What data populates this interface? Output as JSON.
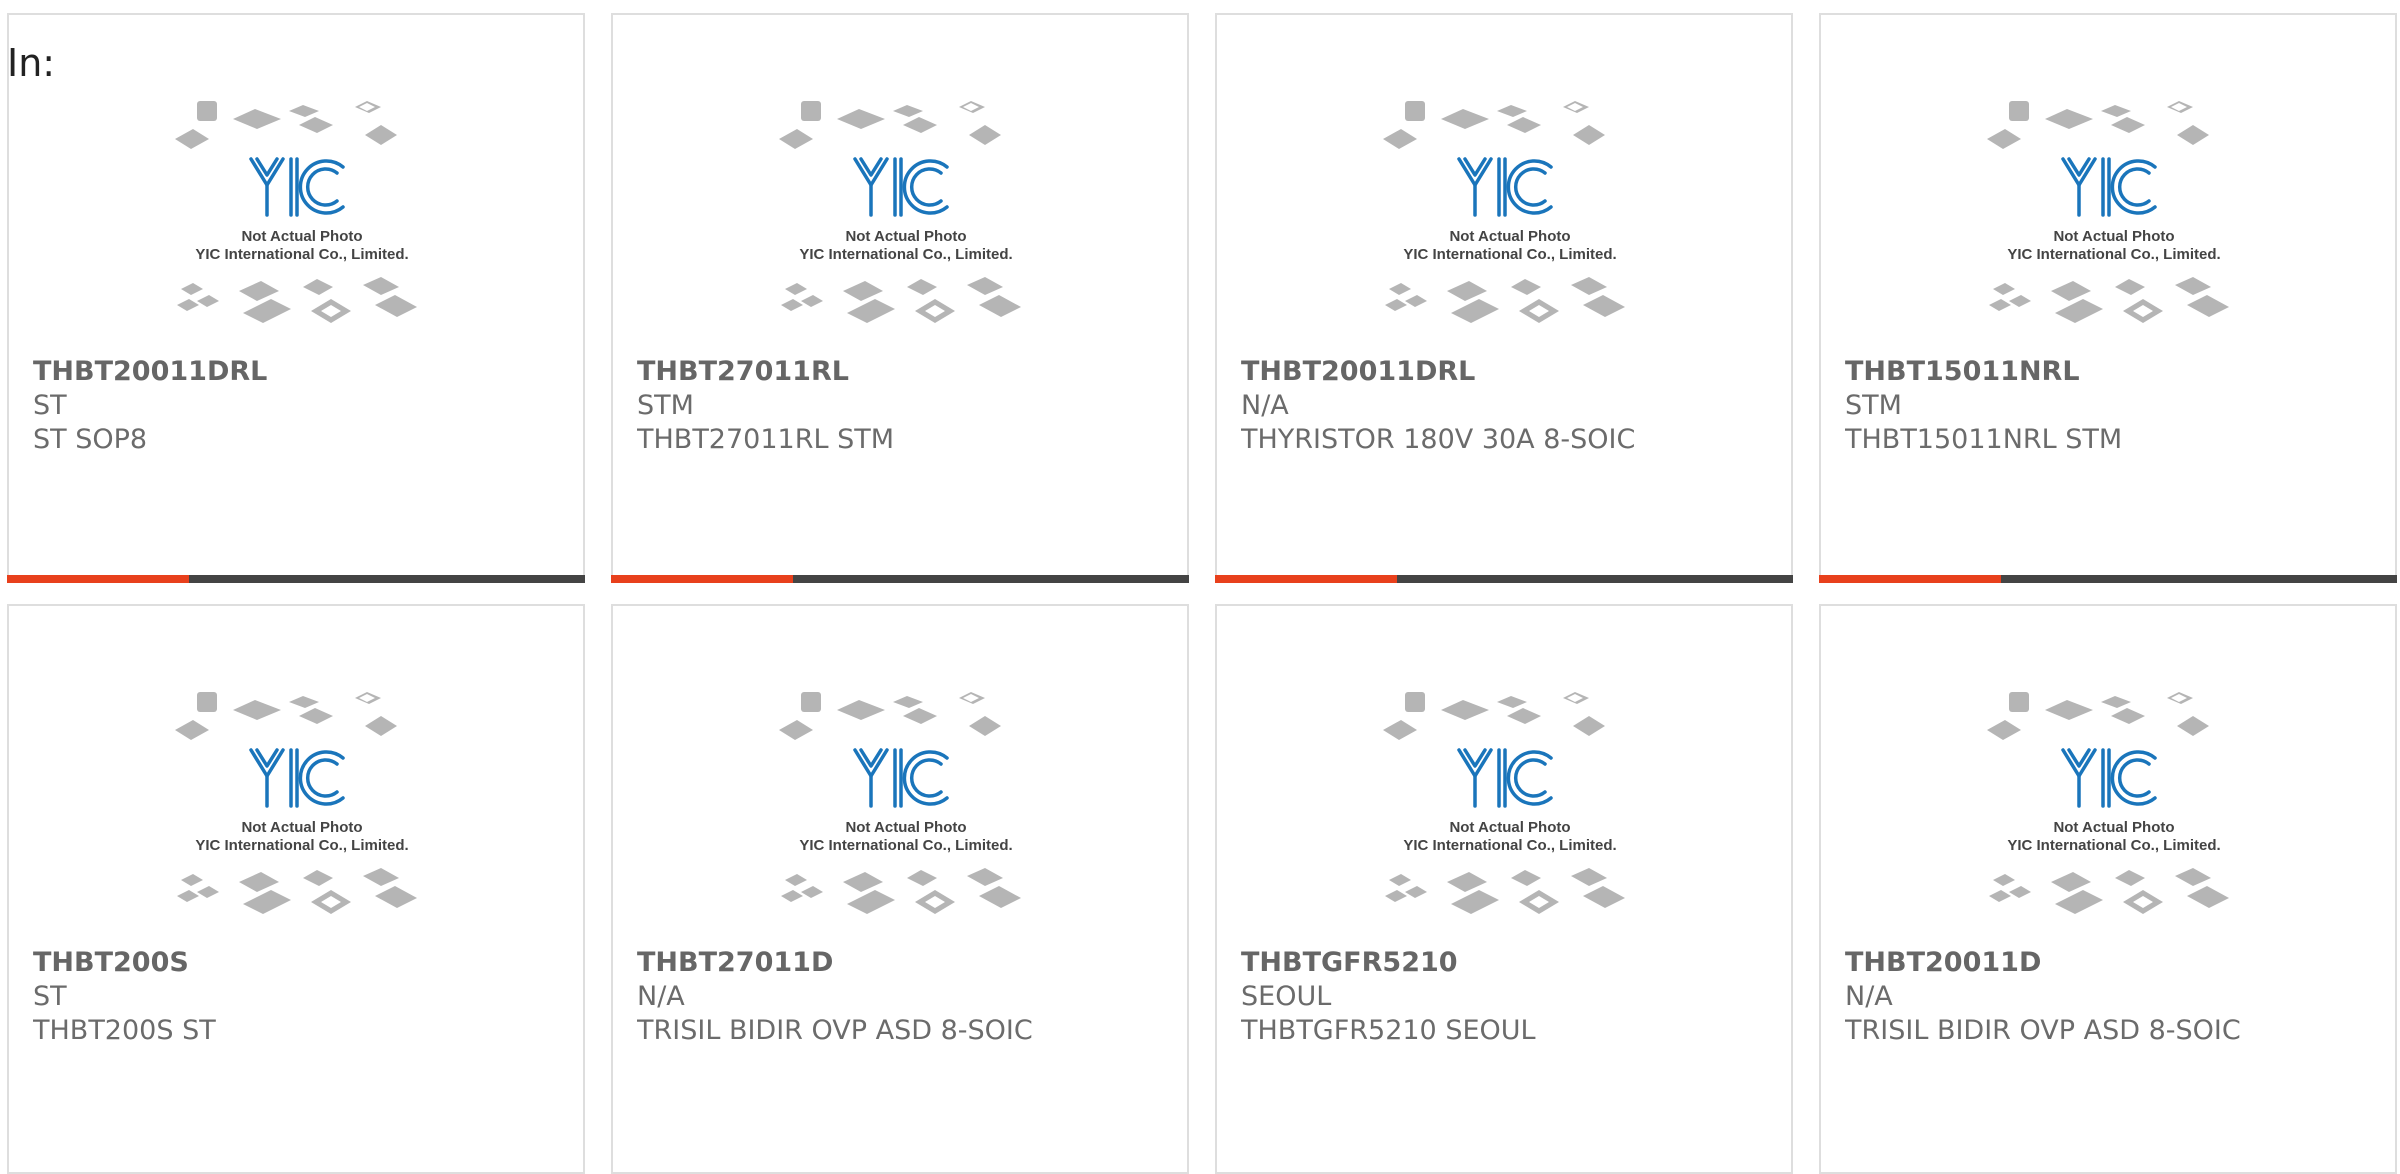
{
  "page": {
    "label": "In:"
  },
  "placeholder_image": {
    "caption_line1": "Not Actual Photo",
    "caption_line2": "YIC International Co., Limited.",
    "logo_text": "YIC",
    "logo_color": "#1a75bb",
    "chip_color": "#b5b5b5"
  },
  "colors": {
    "accent_bar": "#e8401c",
    "bar_base": "#444444",
    "border": "#dedede"
  },
  "products": [
    {
      "part": "THBT20011DRL",
      "manufacturer": "ST",
      "description": "ST SOP8",
      "accent_bar": true
    },
    {
      "part": "THBT27011RL",
      "manufacturer": "STM",
      "description": "THBT27011RL STM",
      "accent_bar": true
    },
    {
      "part": "THBT20011DRL",
      "manufacturer": "N/A",
      "description": "THYRISTOR 180V 30A 8-SOIC",
      "accent_bar": true
    },
    {
      "part": "THBT15011NRL",
      "manufacturer": "STM",
      "description": "THBT15011NRL STM",
      "accent_bar": true
    },
    {
      "part": "THBT200S",
      "manufacturer": "ST",
      "description": "THBT200S ST",
      "accent_bar": false
    },
    {
      "part": "THBT27011D",
      "manufacturer": "N/A",
      "description": "TRISIL BIDIR OVP ASD 8-SOIC",
      "accent_bar": false
    },
    {
      "part": "THBTGFR5210",
      "manufacturer": "SEOUL",
      "description": "THBTGFR5210 SEOUL",
      "accent_bar": false
    },
    {
      "part": "THBT20011D",
      "manufacturer": "N/A",
      "description": "TRISIL BIDIR OVP ASD 8-SOIC",
      "accent_bar": false
    }
  ]
}
